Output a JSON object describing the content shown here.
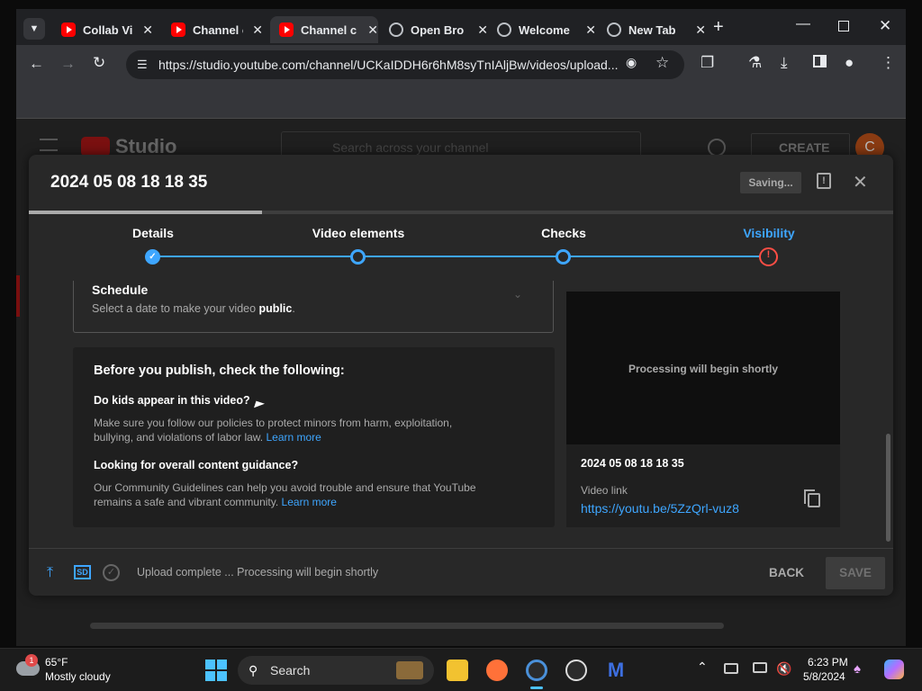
{
  "browser": {
    "tabs": [
      {
        "title": "Collab Vi",
        "active": false,
        "icon": "youtube-icon"
      },
      {
        "title": "Channel c",
        "active": false,
        "icon": "youtube-icon"
      },
      {
        "title": "Channel c",
        "active": true,
        "icon": "youtube-icon"
      },
      {
        "title": "Open Bro",
        "active": false,
        "icon": "obs-icon"
      },
      {
        "title": "Welcome",
        "active": false,
        "icon": "globe-icon"
      },
      {
        "title": "New Tab",
        "active": false,
        "icon": "globe-icon"
      }
    ],
    "new_tab": "+",
    "url": "https://studio.youtube.com/channel/UCKaIDDH6r6hM8syTnIAljBw/videos/upload..."
  },
  "studio_bg": {
    "logo": "Studio",
    "search_placeholder": "Search across your channel",
    "create": "CREATE",
    "avatar": "C"
  },
  "dialog": {
    "title": "2024 05 08 18 18 35",
    "saving": "Saving...",
    "progress_fraction": 0.27,
    "steps": [
      {
        "label": "Details",
        "state": "done"
      },
      {
        "label": "Video elements",
        "state": "current"
      },
      {
        "label": "Checks",
        "state": "current"
      },
      {
        "label": "Visibility",
        "state": "error"
      }
    ],
    "schedule": {
      "title": "Schedule",
      "desc_prefix": "Select a date to make your video ",
      "desc_bold": "public",
      "desc_suffix": "."
    },
    "checklist": {
      "title": "Before you publish, check the following:",
      "q1_title": "Do kids appear in this video?",
      "q1_text": "Make sure you follow our policies to protect minors from harm, exploitation, bullying, and violations of labor law.",
      "q2_title": "Looking for overall content guidance?",
      "q2_text": "Our Community Guidelines can help you avoid trouble and ensure that YouTube remains a safe and vibrant community.",
      "learn_more": "Learn more"
    },
    "preview": {
      "processing": "Processing will begin shortly",
      "video_title": "2024 05 08 18 18 35",
      "link_label": "Video link",
      "link": "https://youtu.be/5ZzQrl-vuz8"
    },
    "footer": {
      "sd": "SD",
      "status": "Upload complete ... Processing will begin shortly",
      "back": "BACK",
      "save": "SAVE"
    }
  },
  "taskbar": {
    "weather_temp": "65°F",
    "weather_desc": "Mostly cloudy",
    "weather_badge": "1",
    "search": "Search",
    "time": "6:23 PM",
    "date": "5/8/2024"
  }
}
